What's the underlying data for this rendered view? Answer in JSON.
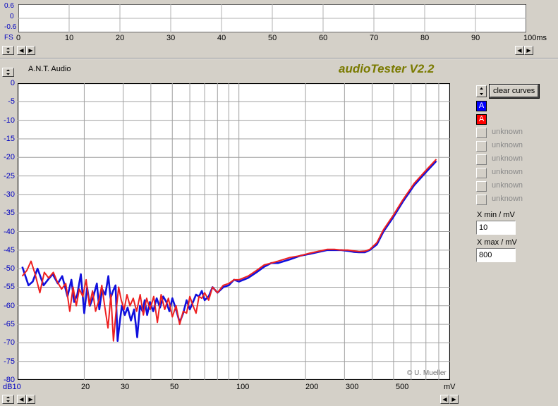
{
  "top_plot": {
    "y_ticks": [
      "0.6",
      "0",
      "-0.6"
    ],
    "fs_label": "FS",
    "x_ticks": [
      "0",
      "10",
      "20",
      "30",
      "40",
      "50",
      "60",
      "70",
      "80",
      "90",
      "100ms"
    ]
  },
  "header": {
    "company": "A.N.T. Audio",
    "app_title": "audioTester V2.2"
  },
  "main_plot": {
    "y_ticks": [
      "0",
      "-5",
      "-10",
      "-15",
      "-20",
      "-25",
      "-30",
      "-35",
      "-40",
      "-45",
      "-50",
      "-55",
      "-60",
      "-65",
      "-70",
      "-75",
      "-80"
    ],
    "x_ticks": [
      "dB10",
      "20",
      "30",
      "50",
      "100",
      "200",
      "300",
      "500",
      "mV"
    ],
    "copyright": "© U. Mueller"
  },
  "sidebar": {
    "clear_button": "clear curves",
    "channels": [
      {
        "label": "A",
        "color": "#0000ff",
        "state": "on"
      },
      {
        "label": "A",
        "color": "#ff0000",
        "state": "on"
      },
      {
        "label": "unknown",
        "state": "off"
      },
      {
        "label": "unknown",
        "state": "off"
      },
      {
        "label": "unknown",
        "state": "off"
      },
      {
        "label": "unknown",
        "state": "off"
      },
      {
        "label": "unknown",
        "state": "off"
      },
      {
        "label": "unknown",
        "state": "off"
      }
    ],
    "xmin_label": "X min / mV",
    "xmin_value": "10",
    "xmax_label": "X max / mV",
    "xmax_value": "800"
  },
  "chart_data": {
    "type": "line",
    "x_scale": "log",
    "xlim": [
      10,
      900
    ],
    "ylim": [
      -80,
      0
    ],
    "xlabel": "mV",
    "ylabel": "dB",
    "grid": true,
    "series": [
      {
        "color": "#1010dd",
        "x": [
          10.5,
          11.2,
          11.7,
          12.3,
          13.1,
          13.7,
          14.4,
          15.2,
          15.9,
          16.8,
          17.5,
          18.0,
          18.6,
          19.3,
          20.0,
          20.6,
          21.2,
          22.0,
          22.8,
          23.4,
          24.1,
          24.9,
          25.7,
          26.3,
          27.0,
          27.7,
          28.3,
          29.0,
          29.6,
          30.5,
          31.4,
          32.5,
          33.6,
          34.7,
          35.7,
          36.7,
          37.5,
          38.5,
          39.6,
          41.0,
          42.5,
          44.0,
          45.5,
          47.0,
          48.5,
          50.0,
          52.0,
          54.0,
          56.0,
          58.0,
          60.0,
          62.0,
          64.0,
          66.0,
          68.0,
          70.0,
          73.0,
          76.0,
          80.0,
          85.0,
          90.0,
          95.0,
          100.0,
          110.0,
          120.0,
          130.0,
          140.0,
          150.0,
          170.0,
          190.0,
          210.0,
          230.0,
          250.0,
          270.0,
          290.0,
          310.0,
          330.0,
          350.0,
          370.0,
          390.0,
          420.0,
          450.0,
          500.0,
          550.0,
          620.0,
          700.0,
          780.0
        ],
        "y": [
          -49.5,
          -54.5,
          -53.5,
          -50.0,
          -54.5,
          -53.0,
          -51.5,
          -54.0,
          -52.0,
          -57.5,
          -53.0,
          -59.0,
          -57.0,
          -51.5,
          -62.0,
          -55.0,
          -60.0,
          -57.5,
          -54.0,
          -61.0,
          -55.5,
          -57.0,
          -52.0,
          -58.0,
          -56.0,
          -54.5,
          -69.5,
          -64.0,
          -60.0,
          -62.5,
          -60.5,
          -64.0,
          -61.0,
          -68.5,
          -60.0,
          -61.5,
          -58.5,
          -62.5,
          -59.0,
          -61.5,
          -58.0,
          -60.5,
          -57.5,
          -59.0,
          -61.5,
          -58.0,
          -61.0,
          -64.5,
          -62.0,
          -58.5,
          -61.0,
          -59.0,
          -57.0,
          -57.5,
          -56.0,
          -58.5,
          -57.5,
          -55.0,
          -56.5,
          -55.0,
          -54.5,
          -53.0,
          -53.5,
          -52.5,
          -51.0,
          -49.5,
          -48.5,
          -48.5,
          -47.5,
          -46.5,
          -46.0,
          -45.5,
          -45.0,
          -45.0,
          -45.0,
          -45.2,
          -45.5,
          -45.6,
          -45.6,
          -45.0,
          -43.5,
          -40.0,
          -36.0,
          -32.0,
          -27.5,
          -24.0,
          -21.0
        ]
      },
      {
        "color": "#ee2020",
        "x": [
          10.5,
          11.0,
          11.5,
          12.0,
          12.6,
          13.2,
          13.8,
          14.5,
          15.1,
          15.8,
          16.5,
          17.2,
          17.8,
          18.4,
          19.0,
          19.7,
          20.4,
          21.1,
          21.8,
          22.5,
          23.3,
          24.0,
          24.8,
          25.6,
          26.4,
          27.1,
          27.8,
          28.6,
          29.4,
          30.3,
          31.2,
          32.2,
          33.3,
          34.5,
          35.8,
          37.0,
          38.3,
          39.7,
          41.2,
          42.8,
          44.5,
          46.2,
          48.0,
          50.0,
          52.0,
          54.0,
          56.0,
          58.0,
          60.0,
          62.0,
          64.0,
          66.0,
          68.0,
          70.0,
          73.0,
          76.0,
          80.0,
          85.0,
          90.0,
          95.0,
          100.0,
          110.0,
          120.0,
          130.0,
          140.0,
          150.0,
          170.0,
          190.0,
          210.0,
          230.0,
          250.0,
          270.0,
          290.0,
          310.0,
          330.0,
          350.0,
          370.0,
          390.0,
          420.0,
          450.0,
          500.0,
          550.0,
          620.0,
          700.0,
          780.0
        ],
        "y": [
          -52.0,
          -50.5,
          -48.0,
          -51.5,
          -56.5,
          -51.0,
          -52.5,
          -51.0,
          -53.5,
          -55.5,
          -54.0,
          -61.5,
          -55.0,
          -60.0,
          -55.5,
          -57.5,
          -53.0,
          -60.0,
          -56.0,
          -61.5,
          -58.5,
          -54.5,
          -60.5,
          -66.0,
          -57.0,
          -69.5,
          -62.0,
          -55.0,
          -58.5,
          -61.0,
          -57.0,
          -60.0,
          -58.0,
          -61.5,
          -57.0,
          -62.5,
          -58.0,
          -61.0,
          -57.5,
          -64.5,
          -57.0,
          -61.0,
          -58.0,
          -63.0,
          -60.0,
          -65.0,
          -61.5,
          -62.0,
          -57.5,
          -60.0,
          -62.0,
          -57.5,
          -58.0,
          -56.5,
          -58.5,
          -55.0,
          -56.5,
          -54.5,
          -54.0,
          -53.0,
          -53.0,
          -52.0,
          -50.5,
          -49.0,
          -48.5,
          -48.0,
          -47.0,
          -46.5,
          -45.8,
          -45.3,
          -44.8,
          -44.8,
          -45.0,
          -45.0,
          -45.2,
          -45.4,
          -45.3,
          -44.8,
          -43.0,
          -39.5,
          -35.5,
          -31.5,
          -27.0,
          -23.5,
          -20.5
        ]
      }
    ]
  }
}
